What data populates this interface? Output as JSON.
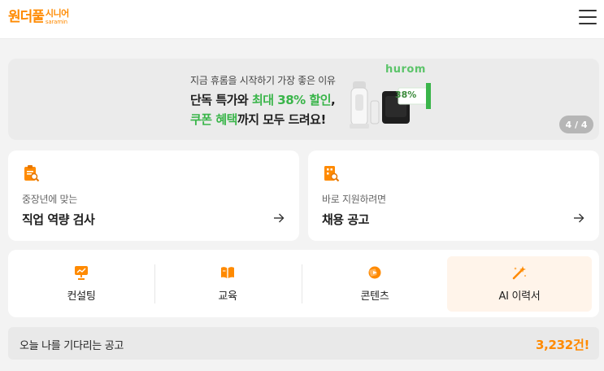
{
  "header": {
    "logo_main": "원더풀",
    "logo_sub_1": "시니어",
    "logo_sub_2": "saramin",
    "menu_icon": "hamburger-menu-icon"
  },
  "banner": {
    "subtitle": "지금 휴롬을 시작하기 가장 좋은 이유",
    "line1_prefix": "단독 특가와 ",
    "line1_highlight": "최대 38% 할인",
    "line1_suffix": ",",
    "line2_highlight": "쿠폰 혜택",
    "line2_suffix": "까지 모두 드려요!",
    "brand": "hurom",
    "discount_tag": "38%",
    "pagination": "4 / 4",
    "highlight_color": "#3ab54a"
  },
  "cards": [
    {
      "subtitle": "중장년에 맞는",
      "title": "직업 역량 검사",
      "icon": "clipboard-search-icon"
    },
    {
      "subtitle": "바로 지원하려면",
      "title": "채용 공고",
      "icon": "building-search-icon"
    }
  ],
  "menu": [
    {
      "label": "컨설팅",
      "icon": "presentation-board-icon",
      "active": false
    },
    {
      "label": "교육",
      "icon": "open-book-icon",
      "active": false
    },
    {
      "label": "콘텐츠",
      "icon": "content-chat-icon",
      "active": false
    },
    {
      "label": "AI 이력서",
      "icon": "magic-wand-icon",
      "active": true
    }
  ],
  "bottom": {
    "label": "오늘 나를 기다리는 공고",
    "count": "3,232건!"
  },
  "colors": {
    "accent": "#ff8a00",
    "green": "#3ab54a",
    "background": "#f3f3f3"
  }
}
